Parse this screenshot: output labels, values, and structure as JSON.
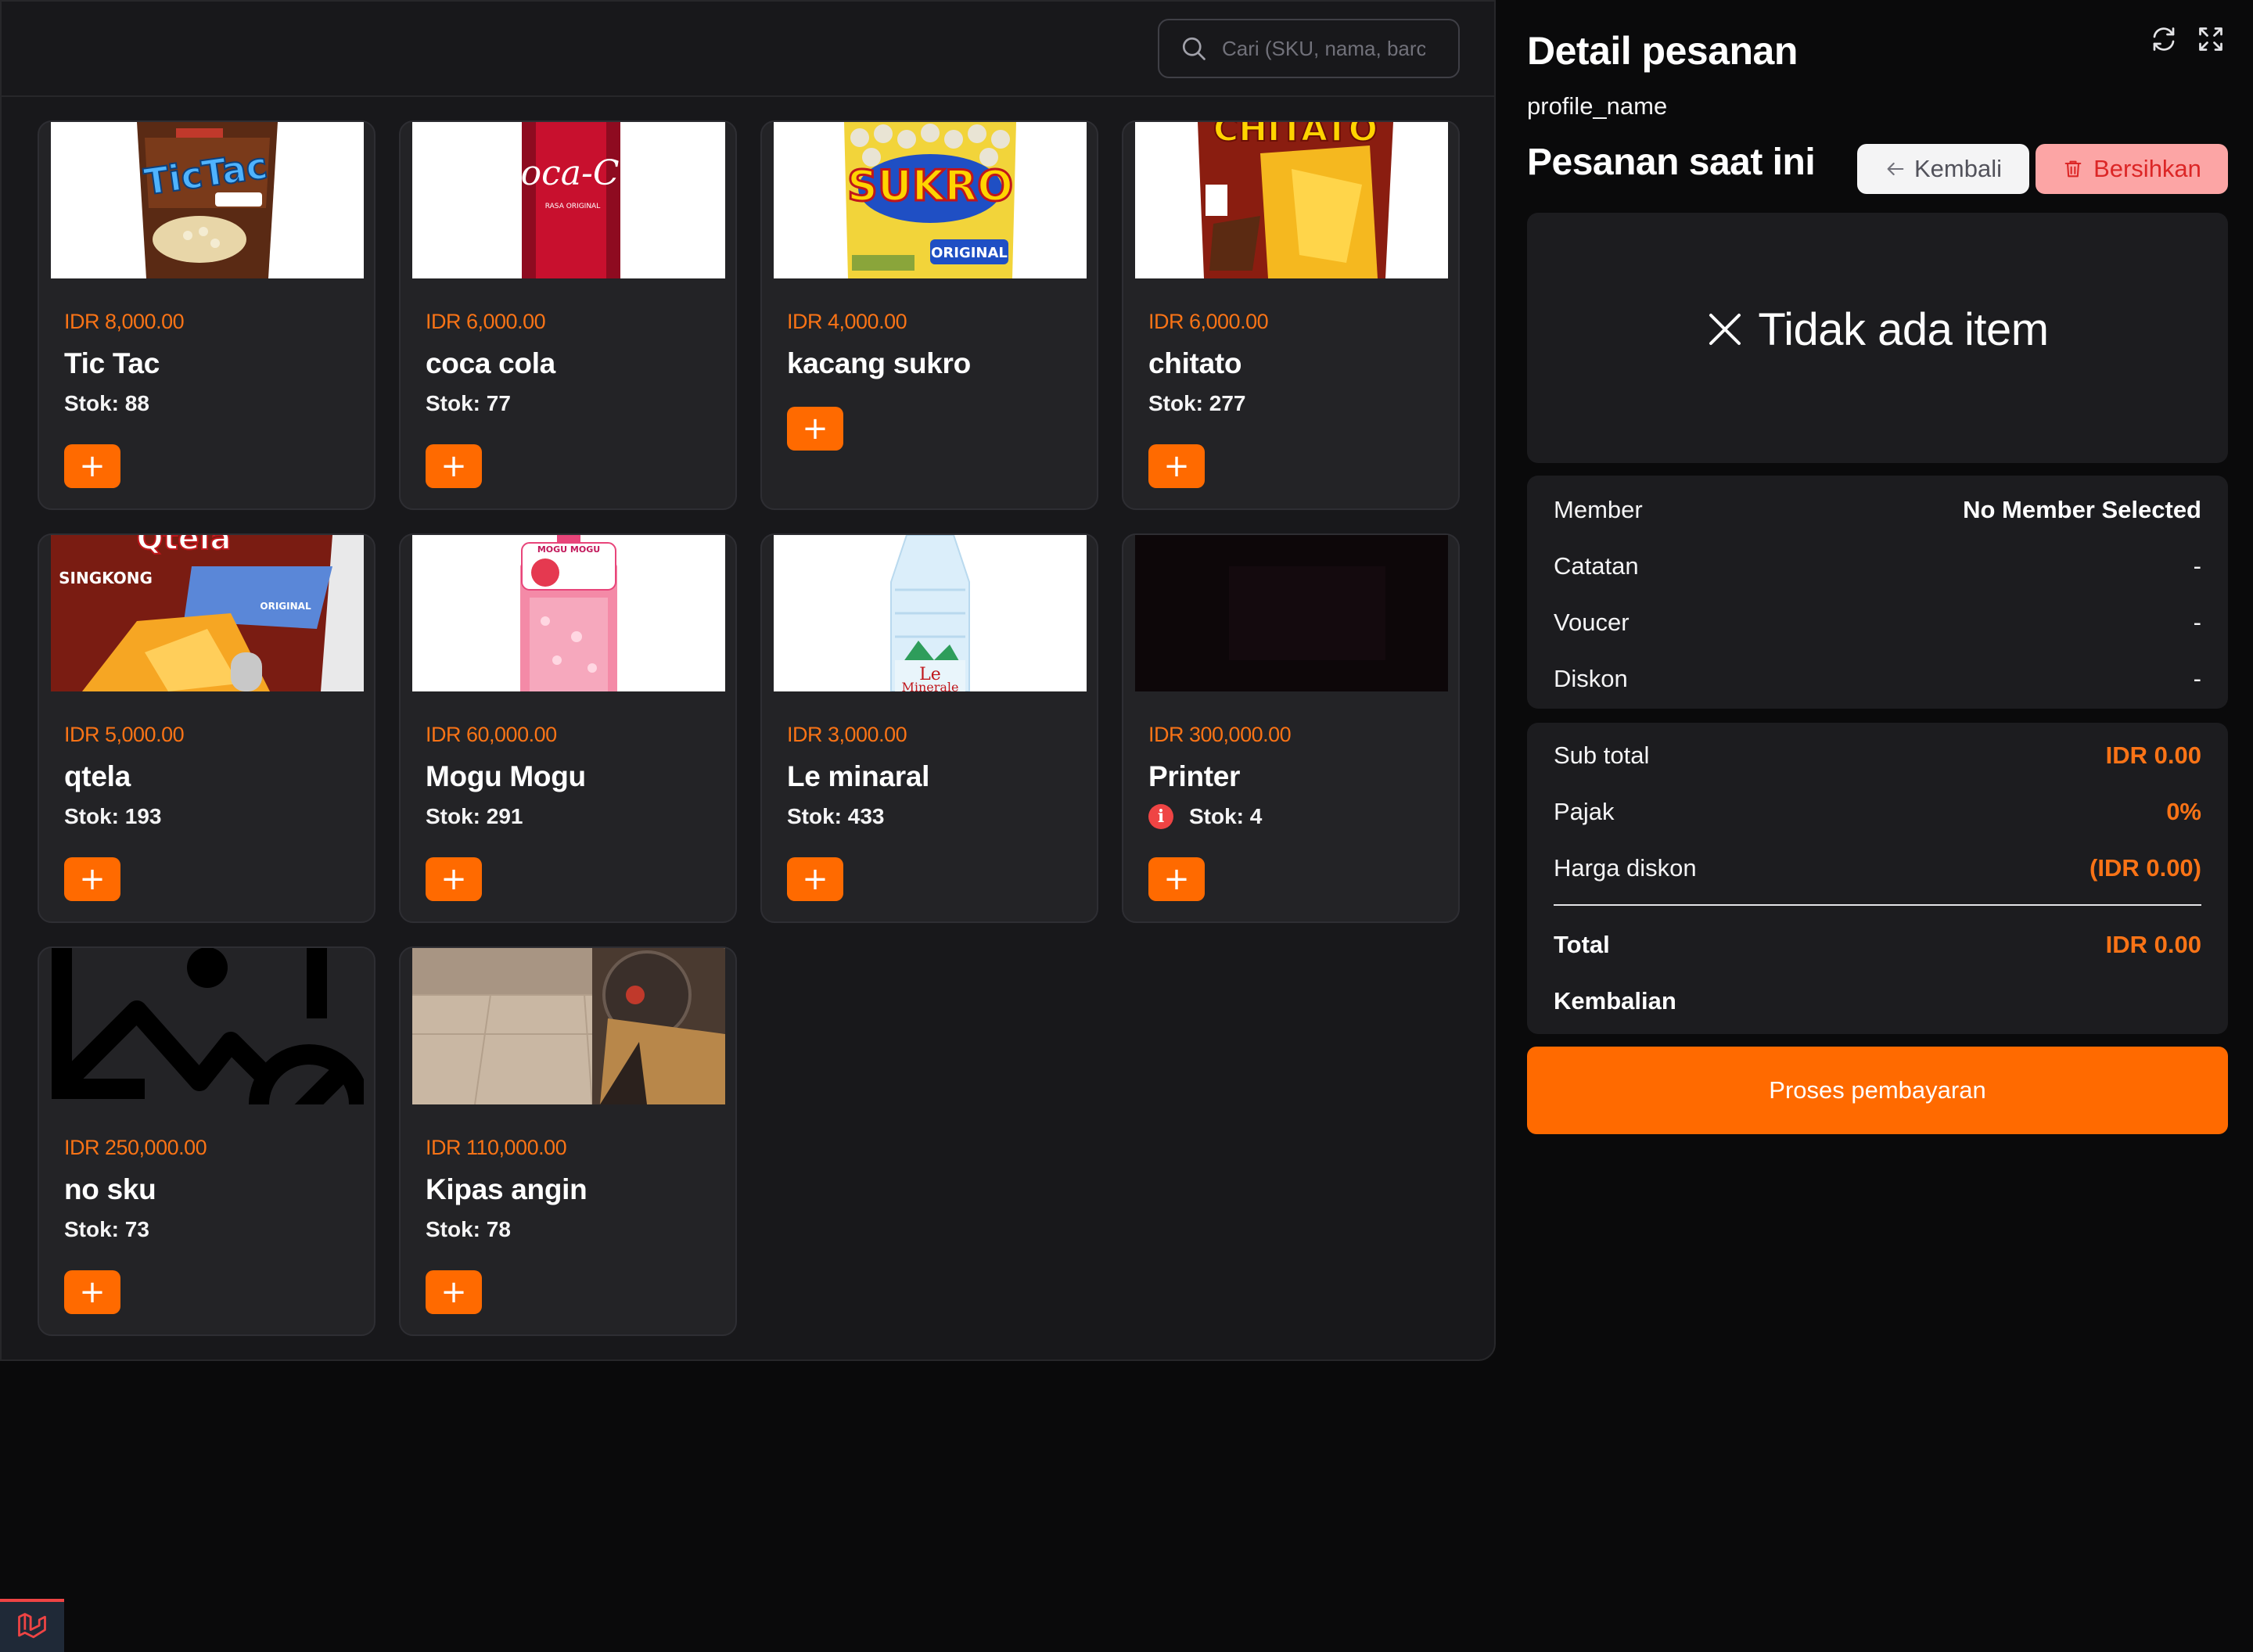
{
  "search": {
    "placeholder": "Cari (SKU, nama, barcode)"
  },
  "products": [
    {
      "price": "IDR 8,000.00",
      "name": "Tic Tac",
      "stock": "Stok: 88",
      "image": "tictac-snack-image"
    },
    {
      "price": "IDR 6,000.00",
      "name": "coca cola",
      "stock": "Stok: 77",
      "image": "coca-cola-can-image"
    },
    {
      "price": "IDR 4,000.00",
      "name": "kacang sukro",
      "stock": "",
      "image": "sukro-peanuts-image"
    },
    {
      "price": "IDR 6,000.00",
      "name": "chitato",
      "stock": "Stok: 277",
      "image": "chitato-chips-image"
    },
    {
      "price": "IDR 5,000.00",
      "name": "qtela",
      "stock": "Stok: 193",
      "image": "qtela-chips-image"
    },
    {
      "price": "IDR 60,000.00",
      "name": "Mogu Mogu",
      "stock": "Stok: 291",
      "image": "mogu-mogu-bottle-image"
    },
    {
      "price": "IDR 3,000.00",
      "name": "Le minaral",
      "stock": "Stok: 433",
      "image": "le-minerale-bottle-image"
    },
    {
      "price": "IDR 300,000.00",
      "name": "Printer",
      "stock": "Stok: 4",
      "image": "printer-image",
      "low_stock": true
    },
    {
      "price": "IDR 250,000.00",
      "name": "no sku",
      "stock": "Stok: 73",
      "image": "placeholder-image"
    },
    {
      "price": "IDR 110,000.00",
      "name": "Kipas angin",
      "stock": "Stok: 78",
      "image": "fan-photo-image"
    }
  ],
  "add_label": "+",
  "detail": {
    "title": "Detail pesanan",
    "profile": "profile_name",
    "current_order": "Pesanan saat ini",
    "back_label": "Kembali",
    "clear_label": "Bersihkan",
    "empty_label": "Tidak ada item",
    "info": {
      "member_label": "Member",
      "member_value": "No Member Selected",
      "note_label": "Catatan",
      "note_value": "-",
      "voucher_label": "Voucer",
      "voucher_value": "-",
      "discount_label": "Diskon",
      "discount_value": "-"
    },
    "totals": {
      "subtotal_label": "Sub total",
      "subtotal_value": "IDR 0.00",
      "tax_label": "Pajak",
      "tax_value": "0%",
      "discount_price_label": "Harga diskon",
      "discount_price_value": "(IDR 0.00)",
      "total_label": "Total",
      "total_value": "IDR 0.00",
      "change_label": "Kembalian",
      "change_value": ""
    },
    "pay_label": "Proses pembayaran"
  },
  "colors": {
    "accent": "#ff6a00",
    "price": "#f97316",
    "panel": "#18181b",
    "card": "#232326"
  }
}
